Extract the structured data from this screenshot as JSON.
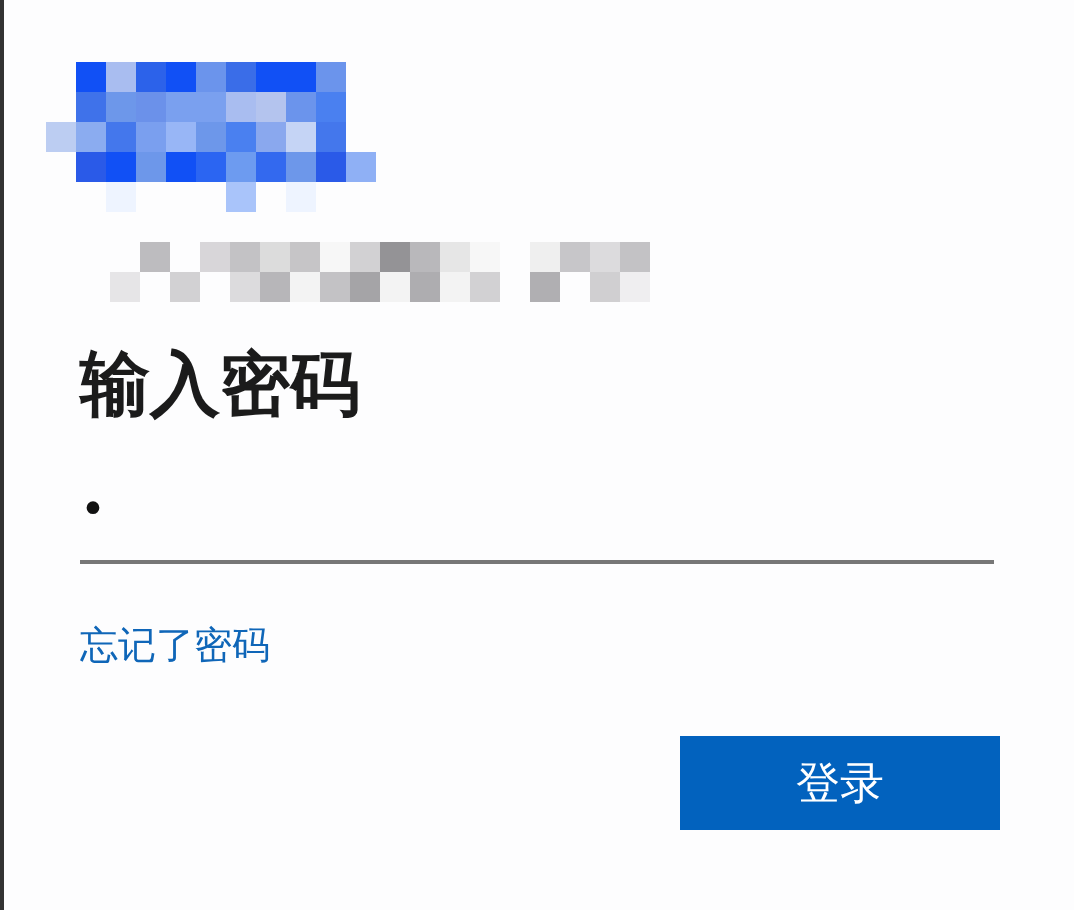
{
  "heading": "输入密码",
  "password": {
    "value": "•"
  },
  "forgot_link": "忘记了密码",
  "buttons": [
    {
      "label": "登录",
      "kind": "primary"
    }
  ]
}
